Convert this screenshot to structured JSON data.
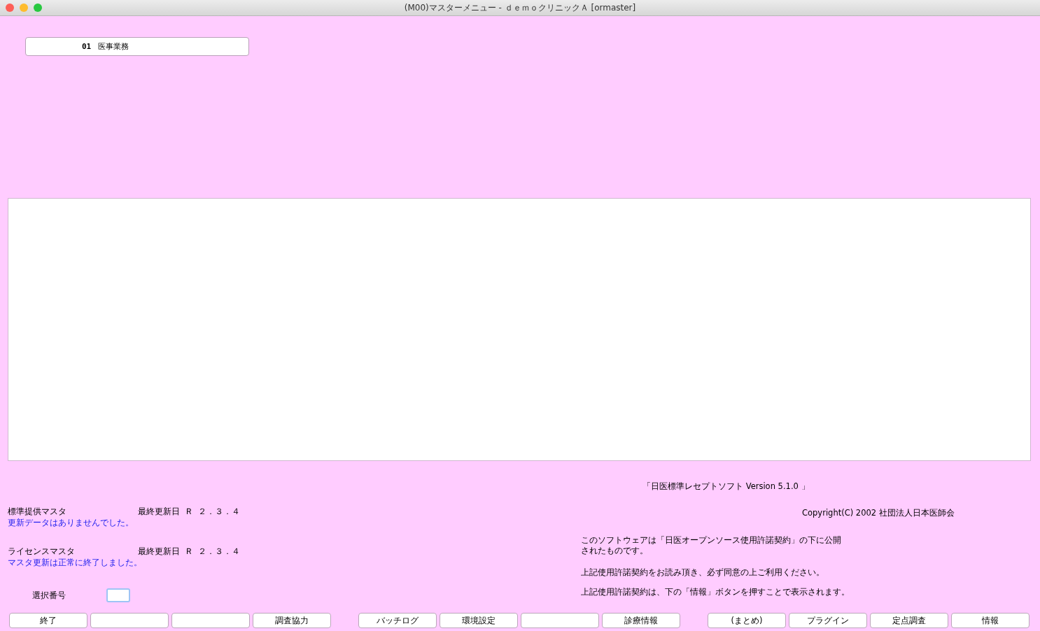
{
  "window": {
    "title": "(M00)マスターメニュー - ｄｅｍｏクリニックＡ  [ormaster]"
  },
  "menu_items": [
    {
      "number": "01",
      "label": "医事業務"
    }
  ],
  "masters": [
    {
      "name": "標準提供マスタ",
      "updated_label": "最終更新日",
      "updated": "Ｒ ２．３．４",
      "message": "更新データはありませんでした。"
    },
    {
      "name": "ライセンスマスタ",
      "updated_label": "最終更新日",
      "updated": "Ｒ ２．３．４",
      "message": "マスタ更新は正常に終了しました。"
    }
  ],
  "selection": {
    "label": "選択番号",
    "focused": true
  },
  "about": {
    "version": "「日医標準レセプトソフト  Version  5.1.0 」",
    "copyright": "Copyright(C) 2002 社団法人日本医師会",
    "license_lines": [
      "このソフトウェアは「日医オープンソース使用許諾契約」の下に公開",
      "されたものです。"
    ],
    "notes": [
      "上記使用許諾契約をお読み頂き、必ず同意の上ご利用ください。",
      "上記使用許諾契約は、下の「情報」ボタンを押すことで表示されます。"
    ]
  },
  "function_keys": [
    [
      {
        "kind": "labeled",
        "label": "終了"
      },
      {
        "kind": "blank"
      },
      {
        "kind": "blank"
      },
      {
        "kind": "labeled",
        "label": "調査協力"
      }
    ],
    [
      {
        "kind": "labeled",
        "label": "バッチログ"
      },
      {
        "kind": "labeled",
        "label": "環境設定"
      },
      {
        "kind": "blank"
      },
      {
        "kind": "labeled",
        "label": "診療情報"
      }
    ],
    [
      {
        "kind": "labeled",
        "label": "(まとめ)"
      },
      {
        "kind": "labeled",
        "label": "プラグイン"
      },
      {
        "kind": "labeled",
        "label": "定点調査"
      },
      {
        "kind": "labeled",
        "label": "情報"
      }
    ]
  ]
}
